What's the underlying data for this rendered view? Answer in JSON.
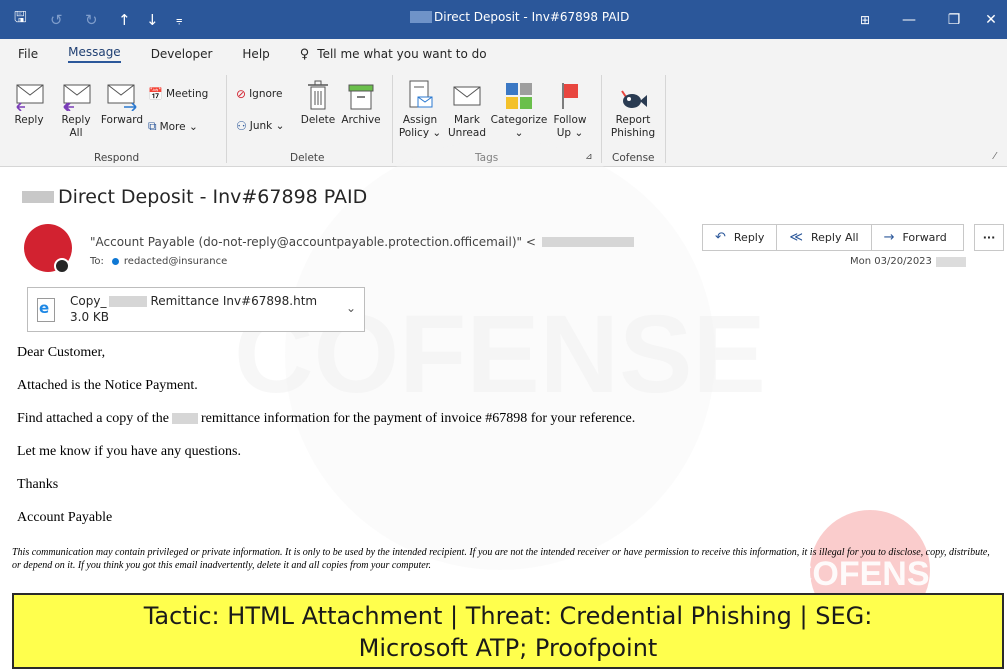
{
  "window": {
    "title": "Direct Deposit - Inv#67898 PAID",
    "minimize": "—",
    "restore": "❐",
    "close": "✕"
  },
  "menu": {
    "items": [
      "File",
      "Message",
      "Developer",
      "Help"
    ],
    "active": "Message",
    "tell_me": "Tell me what you want to do"
  },
  "ribbon": {
    "respond": {
      "group": "Respond",
      "reply": "Reply",
      "reply_all": "Reply All",
      "forward": "Forward",
      "meeting": "Meeting",
      "more": "More ⌄"
    },
    "delete": {
      "group": "Delete",
      "ignore": "Ignore",
      "junk": "Junk ⌄",
      "delete": "Delete",
      "archive": "Archive"
    },
    "tags": {
      "group": "Tags",
      "assign_policy": "Assign Policy ⌄",
      "mark_unread": "Mark Unread",
      "categorize": "Categorize ⌄",
      "follow_up": "Follow Up ⌄"
    },
    "cofense": {
      "group": "Cofense",
      "report_phishing": "Report Phishing"
    }
  },
  "message": {
    "subject": "Direct Deposit - Inv#67898 PAID",
    "sender": "\"Account Payable (do-not-reply@accountpayable.protection.officemail)\" <",
    "to_label": "To:",
    "to_value": "redacted@insurance",
    "date": "Mon 03/20/2023",
    "actions": {
      "reply": "Reply",
      "reply_all": "Reply All",
      "forward": "Forward",
      "more": "···"
    },
    "attachment": {
      "name_prefix": "Copy_",
      "name_suffix": "Remittance Inv#67898.htm",
      "size": "3.0 KB"
    },
    "body": {
      "greeting": "Dear Customer,",
      "line1": "Attached is the Notice Payment.",
      "line2_a": "Find attached a copy of the",
      "line2_b": "remittance information for the payment of invoice #67898 for your reference.",
      "line3": "Let me know if you have any questions.",
      "line4": "Thanks",
      "signature": "Account Payable"
    },
    "disclaimer": "This communication may contain privileged or private information. It is only to be used by the intended recipient. If you are not the intended receiver or have permission to receive this information, it is illegal for you to disclose, copy, distribute, or depend on it. If you think you got this email inadvertently, delete it and all copies from your computer."
  },
  "watermark": {
    "text": "COFENSE"
  },
  "banner": {
    "line1": "Tactic: HTML Attachment | Threat: Credential Phishing | SEG:",
    "line2": "Microsoft ATP; Proofpoint"
  },
  "colors": {
    "titlebar": "#2b579a",
    "avatar": "#d22230",
    "banner": "#ffff4d"
  }
}
